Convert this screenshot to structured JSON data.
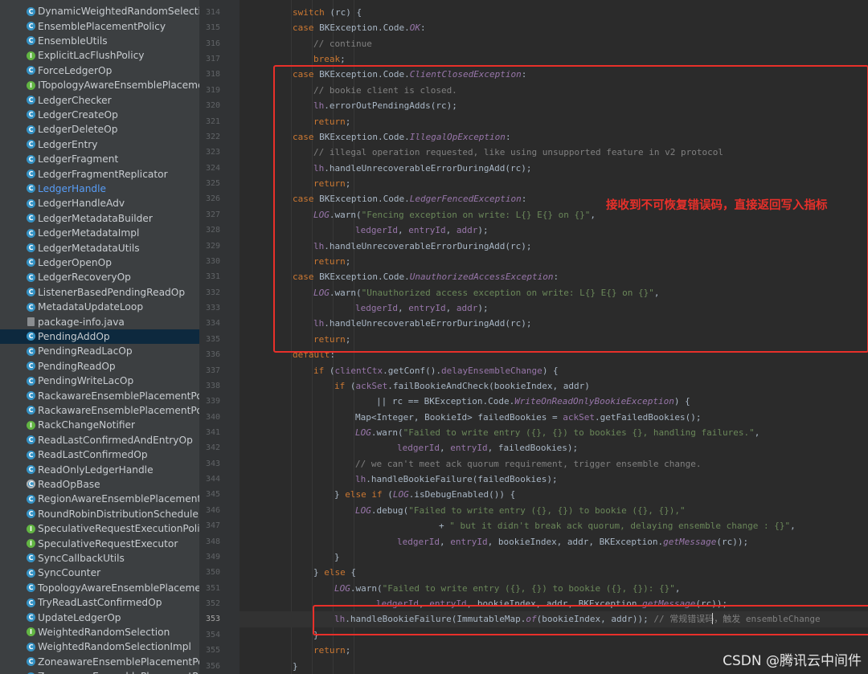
{
  "project_tree": {
    "items": [
      {
        "label": "DynamicWeightedRandomSelectionI",
        "icon": "class-icon"
      },
      {
        "label": "EnsemblePlacementPolicy",
        "icon": "class-icon"
      },
      {
        "label": "EnsembleUtils",
        "icon": "class-icon"
      },
      {
        "label": "ExplicitLacFlushPolicy",
        "icon": "interface-icon"
      },
      {
        "label": "ForceLedgerOp",
        "icon": "class-icon"
      },
      {
        "label": "ITopologyAwareEnsemblePlacement",
        "icon": "interface-icon"
      },
      {
        "label": "LedgerChecker",
        "icon": "class-icon"
      },
      {
        "label": "LedgerCreateOp",
        "icon": "class-icon"
      },
      {
        "label": "LedgerDeleteOp",
        "icon": "class-icon"
      },
      {
        "label": "LedgerEntry",
        "icon": "class-icon"
      },
      {
        "label": "LedgerFragment",
        "icon": "class-icon"
      },
      {
        "label": "LedgerFragmentReplicator",
        "icon": "class-icon"
      },
      {
        "label": "LedgerHandle",
        "icon": "class-icon",
        "state": "link"
      },
      {
        "label": "LedgerHandleAdv",
        "icon": "class-icon"
      },
      {
        "label": "LedgerMetadataBuilder",
        "icon": "class-icon"
      },
      {
        "label": "LedgerMetadataImpl",
        "icon": "class-icon"
      },
      {
        "label": "LedgerMetadataUtils",
        "icon": "class-icon"
      },
      {
        "label": "LedgerOpenOp",
        "icon": "class-icon"
      },
      {
        "label": "LedgerRecoveryOp",
        "icon": "class-icon"
      },
      {
        "label": "ListenerBasedPendingReadOp",
        "icon": "class-icon"
      },
      {
        "label": "MetadataUpdateLoop",
        "icon": "class-icon"
      },
      {
        "label": "package-info.java",
        "icon": "java-file-icon"
      },
      {
        "label": "PendingAddOp",
        "icon": "class-icon",
        "state": "selected"
      },
      {
        "label": "PendingReadLacOp",
        "icon": "class-icon"
      },
      {
        "label": "PendingReadOp",
        "icon": "class-icon"
      },
      {
        "label": "PendingWriteLacOp",
        "icon": "class-icon"
      },
      {
        "label": "RackawareEnsemblePlacementPolicy",
        "icon": "class-icon"
      },
      {
        "label": "RackawareEnsemblePlacementPolicy",
        "icon": "class-icon"
      },
      {
        "label": "RackChangeNotifier",
        "icon": "interface-icon"
      },
      {
        "label": "ReadLastConfirmedAndEntryOp",
        "icon": "class-icon"
      },
      {
        "label": "ReadLastConfirmedOp",
        "icon": "class-icon"
      },
      {
        "label": "ReadOnlyLedgerHandle",
        "icon": "class-icon"
      },
      {
        "label": "ReadOpBase",
        "icon": "abstract-class-icon"
      },
      {
        "label": "RegionAwareEnsemblePlacementPol",
        "icon": "class-icon"
      },
      {
        "label": "RoundRobinDistributionSchedule",
        "icon": "class-icon"
      },
      {
        "label": "SpeculativeRequestExecutionPolicy",
        "icon": "interface-icon"
      },
      {
        "label": "SpeculativeRequestExecutor",
        "icon": "interface-icon"
      },
      {
        "label": "SyncCallbackUtils",
        "icon": "class-icon"
      },
      {
        "label": "SyncCounter",
        "icon": "class-icon"
      },
      {
        "label": "TopologyAwareEnsemblePlacementP",
        "icon": "class-icon"
      },
      {
        "label": "TryReadLastConfirmedOp",
        "icon": "class-icon"
      },
      {
        "label": "UpdateLedgerOp",
        "icon": "class-icon"
      },
      {
        "label": "WeightedRandomSelection",
        "icon": "interface-icon"
      },
      {
        "label": "WeightedRandomSelectionImpl",
        "icon": "class-icon"
      },
      {
        "label": "ZoneawareEnsemblePlacementPolic",
        "icon": "class-icon"
      },
      {
        "label": "ZoneawareEnsemblePlacementPolic",
        "icon": "class-icon"
      }
    ]
  },
  "editor": {
    "current_line": 353,
    "colors": {
      "keyword": "#cc7832",
      "comment": "#808080",
      "string": "#6a8759",
      "field": "#9876aa",
      "plain": "#a9b7c6"
    },
    "lines": [
      {
        "n": 314,
        "indent": 0,
        "tokens": [
          [
            "kw",
            "switch"
          ],
          [
            "pl",
            " (rc) {"
          ]
        ]
      },
      {
        "n": 315,
        "indent": 0,
        "tokens": [
          [
            "kw",
            "case "
          ],
          [
            "pl",
            "BKException.Code."
          ],
          [
            "it",
            "OK"
          ],
          [
            "pl",
            ":"
          ]
        ]
      },
      {
        "n": 316,
        "indent": 1,
        "tokens": [
          [
            "cm",
            "// continue"
          ]
        ]
      },
      {
        "n": 317,
        "indent": 1,
        "tokens": [
          [
            "kw",
            "break"
          ],
          [
            "pl",
            ";"
          ]
        ]
      },
      {
        "n": 318,
        "indent": 0,
        "tokens": [
          [
            "kw",
            "case "
          ],
          [
            "pl",
            "BKException.Code."
          ],
          [
            "it",
            "ClientClosedException"
          ],
          [
            "pl",
            ":"
          ]
        ]
      },
      {
        "n": 319,
        "indent": 1,
        "tokens": [
          [
            "cm",
            "// bookie client is closed."
          ]
        ]
      },
      {
        "n": 320,
        "indent": 1,
        "tokens": [
          [
            "fd",
            "lh"
          ],
          [
            "pl",
            ".errorOutPendingAdds(rc);"
          ]
        ]
      },
      {
        "n": 321,
        "indent": 1,
        "tokens": [
          [
            "kw",
            "return"
          ],
          [
            "pl",
            ";"
          ]
        ]
      },
      {
        "n": 322,
        "indent": 0,
        "tokens": [
          [
            "kw",
            "case "
          ],
          [
            "pl",
            "BKException.Code."
          ],
          [
            "it",
            "IllegalOpException"
          ],
          [
            "pl",
            ":"
          ]
        ]
      },
      {
        "n": 323,
        "indent": 1,
        "tokens": [
          [
            "cm",
            "// illegal operation requested, like using unsupported feature in v2 protocol"
          ]
        ]
      },
      {
        "n": 324,
        "indent": 1,
        "tokens": [
          [
            "fd",
            "lh"
          ],
          [
            "pl",
            ".handleUnrecoverableErrorDuringAdd(rc);"
          ]
        ]
      },
      {
        "n": 325,
        "indent": 1,
        "tokens": [
          [
            "kw",
            "return"
          ],
          [
            "pl",
            ";"
          ]
        ]
      },
      {
        "n": 326,
        "indent": 0,
        "tokens": [
          [
            "kw",
            "case "
          ],
          [
            "pl",
            "BKException.Code."
          ],
          [
            "it",
            "LedgerFencedException"
          ],
          [
            "pl",
            ":"
          ]
        ]
      },
      {
        "n": 327,
        "indent": 1,
        "tokens": [
          [
            "it",
            "LOG"
          ],
          [
            "pl",
            ".warn("
          ],
          [
            "st",
            "\"Fencing exception on write: L{} E{} on {}\""
          ],
          [
            "pl",
            ","
          ]
        ]
      },
      {
        "n": 328,
        "indent": 3,
        "tokens": [
          [
            "fd",
            "ledgerId"
          ],
          [
            "pl",
            ", "
          ],
          [
            "fd",
            "entryId"
          ],
          [
            "pl",
            ", "
          ],
          [
            "fd",
            "addr"
          ],
          [
            "pl",
            ");"
          ]
        ]
      },
      {
        "n": 329,
        "indent": 1,
        "tokens": [
          [
            "fd",
            "lh"
          ],
          [
            "pl",
            ".handleUnrecoverableErrorDuringAdd(rc);"
          ]
        ]
      },
      {
        "n": 330,
        "indent": 1,
        "tokens": [
          [
            "kw",
            "return"
          ],
          [
            "pl",
            ";"
          ]
        ]
      },
      {
        "n": 331,
        "indent": 0,
        "tokens": [
          [
            "kw",
            "case "
          ],
          [
            "pl",
            "BKException.Code."
          ],
          [
            "it",
            "UnauthorizedAccessException"
          ],
          [
            "pl",
            ":"
          ]
        ]
      },
      {
        "n": 332,
        "indent": 1,
        "tokens": [
          [
            "it",
            "LOG"
          ],
          [
            "pl",
            ".warn("
          ],
          [
            "st",
            "\"Unauthorized access exception on write: L{} E{} on {}\""
          ],
          [
            "pl",
            ","
          ]
        ]
      },
      {
        "n": 333,
        "indent": 3,
        "tokens": [
          [
            "fd",
            "ledgerId"
          ],
          [
            "pl",
            ", "
          ],
          [
            "fd",
            "entryId"
          ],
          [
            "pl",
            ", "
          ],
          [
            "fd",
            "addr"
          ],
          [
            "pl",
            ");"
          ]
        ]
      },
      {
        "n": 334,
        "indent": 1,
        "tokens": [
          [
            "fd",
            "lh"
          ],
          [
            "pl",
            ".handleUnrecoverableErrorDuringAdd(rc);"
          ]
        ]
      },
      {
        "n": 335,
        "indent": 1,
        "tokens": [
          [
            "kw",
            "return"
          ],
          [
            "pl",
            ";"
          ]
        ]
      },
      {
        "n": 336,
        "indent": 0,
        "tokens": [
          [
            "kw",
            "default"
          ],
          [
            "pl",
            ":"
          ]
        ]
      },
      {
        "n": 337,
        "indent": 1,
        "tokens": [
          [
            "kw",
            "if "
          ],
          [
            "pl",
            "("
          ],
          [
            "fd",
            "clientCtx"
          ],
          [
            "pl",
            ".getConf()."
          ],
          [
            "fd",
            "delayEnsembleChange"
          ],
          [
            "pl",
            ") {"
          ]
        ]
      },
      {
        "n": 338,
        "indent": 2,
        "tokens": [
          [
            "kw",
            "if "
          ],
          [
            "pl",
            "("
          ],
          [
            "fd",
            "ackSet"
          ],
          [
            "pl",
            ".failBookieAndCheck(bookieIndex, addr)"
          ]
        ]
      },
      {
        "n": 339,
        "indent": 4,
        "tokens": [
          [
            "pl",
            "|| rc == BKException.Code."
          ],
          [
            "it",
            "WriteOnReadOnlyBookieException"
          ],
          [
            "pl",
            ") {"
          ]
        ]
      },
      {
        "n": 340,
        "indent": 3,
        "tokens": [
          [
            "pl",
            "Map<Integer, BookieId> failedBookies = "
          ],
          [
            "fd",
            "ackSet"
          ],
          [
            "pl",
            ".getFailedBookies();"
          ]
        ]
      },
      {
        "n": 341,
        "indent": 3,
        "tokens": [
          [
            "it",
            "LOG"
          ],
          [
            "pl",
            ".warn("
          ],
          [
            "st",
            "\"Failed to write entry ({}, {}) to bookies {}, handling failures.\""
          ],
          [
            "pl",
            ","
          ]
        ]
      },
      {
        "n": 342,
        "indent": 5,
        "tokens": [
          [
            "fd",
            "ledgerId"
          ],
          [
            "pl",
            ", "
          ],
          [
            "fd",
            "entryId"
          ],
          [
            "pl",
            ", failedBookies);"
          ]
        ]
      },
      {
        "n": 343,
        "indent": 3,
        "tokens": [
          [
            "cm",
            "// we can't meet ack quorum requirement, trigger ensemble change."
          ]
        ]
      },
      {
        "n": 344,
        "indent": 3,
        "tokens": [
          [
            "fd",
            "lh"
          ],
          [
            "pl",
            ".handleBookieFailure(failedBookies);"
          ]
        ]
      },
      {
        "n": 345,
        "indent": 2,
        "tokens": [
          [
            "pl",
            "} "
          ],
          [
            "kw",
            "else if "
          ],
          [
            "pl",
            "("
          ],
          [
            "it",
            "LOG"
          ],
          [
            "pl",
            ".isDebugEnabled()) {"
          ]
        ]
      },
      {
        "n": 346,
        "indent": 3,
        "tokens": [
          [
            "it",
            "LOG"
          ],
          [
            "pl",
            ".debug("
          ],
          [
            "st",
            "\"Failed to write entry ({}, {}) to bookie ({}, {}),\""
          ]
        ]
      },
      {
        "n": 347,
        "indent": 7,
        "tokens": [
          [
            "pl",
            "+ "
          ],
          [
            "st",
            "\" but it didn't break ack quorum, delaying ensemble change : {}\""
          ],
          [
            "pl",
            ","
          ]
        ]
      },
      {
        "n": 348,
        "indent": 5,
        "tokens": [
          [
            "fd",
            "ledgerId"
          ],
          [
            "pl",
            ", "
          ],
          [
            "fd",
            "entryId"
          ],
          [
            "pl",
            ", bookieIndex, addr, BKException."
          ],
          [
            "it",
            "getMessage"
          ],
          [
            "pl",
            "(rc));"
          ]
        ]
      },
      {
        "n": 349,
        "indent": 2,
        "tokens": [
          [
            "pl",
            "}"
          ]
        ]
      },
      {
        "n": 350,
        "indent": 1,
        "tokens": [
          [
            "pl",
            "} "
          ],
          [
            "kw",
            "else "
          ],
          [
            "pl",
            "{"
          ]
        ]
      },
      {
        "n": 351,
        "indent": 2,
        "tokens": [
          [
            "it",
            "LOG"
          ],
          [
            "pl",
            ".warn("
          ],
          [
            "st",
            "\"Failed to write entry ({}, {}) to bookie ({}, {}): {}\""
          ],
          [
            "pl",
            ","
          ]
        ]
      },
      {
        "n": 352,
        "indent": 4,
        "tokens": [
          [
            "fd",
            "ledgerId"
          ],
          [
            "pl",
            ", "
          ],
          [
            "fd",
            "entryId"
          ],
          [
            "pl",
            ", bookieIndex, addr, BKException."
          ],
          [
            "it",
            "getMessage"
          ],
          [
            "pl",
            "(rc));"
          ]
        ]
      },
      {
        "n": 353,
        "indent": 2,
        "tokens": [
          [
            "fd",
            "lh"
          ],
          [
            "pl",
            ".handleBookieFailure(ImmutableMap."
          ],
          [
            "it",
            "of"
          ],
          [
            "pl",
            "(bookieIndex, addr)); "
          ],
          [
            "cm",
            "// 常规错误码，触发 ensembleChange"
          ]
        ]
      },
      {
        "n": 354,
        "indent": 1,
        "tokens": [
          [
            "pl",
            "}"
          ]
        ]
      },
      {
        "n": 355,
        "indent": 1,
        "tokens": [
          [
            "kw",
            "return"
          ],
          [
            "pl",
            ";"
          ]
        ]
      },
      {
        "n": 356,
        "indent": 0,
        "tokens": [
          [
            "pl",
            "}"
          ]
        ]
      }
    ]
  },
  "annotation": {
    "note": "接收到不可恢复错误码，直接返回写入指标",
    "color": "#e8302a"
  },
  "watermark": "CSDN @腾讯云中间件"
}
